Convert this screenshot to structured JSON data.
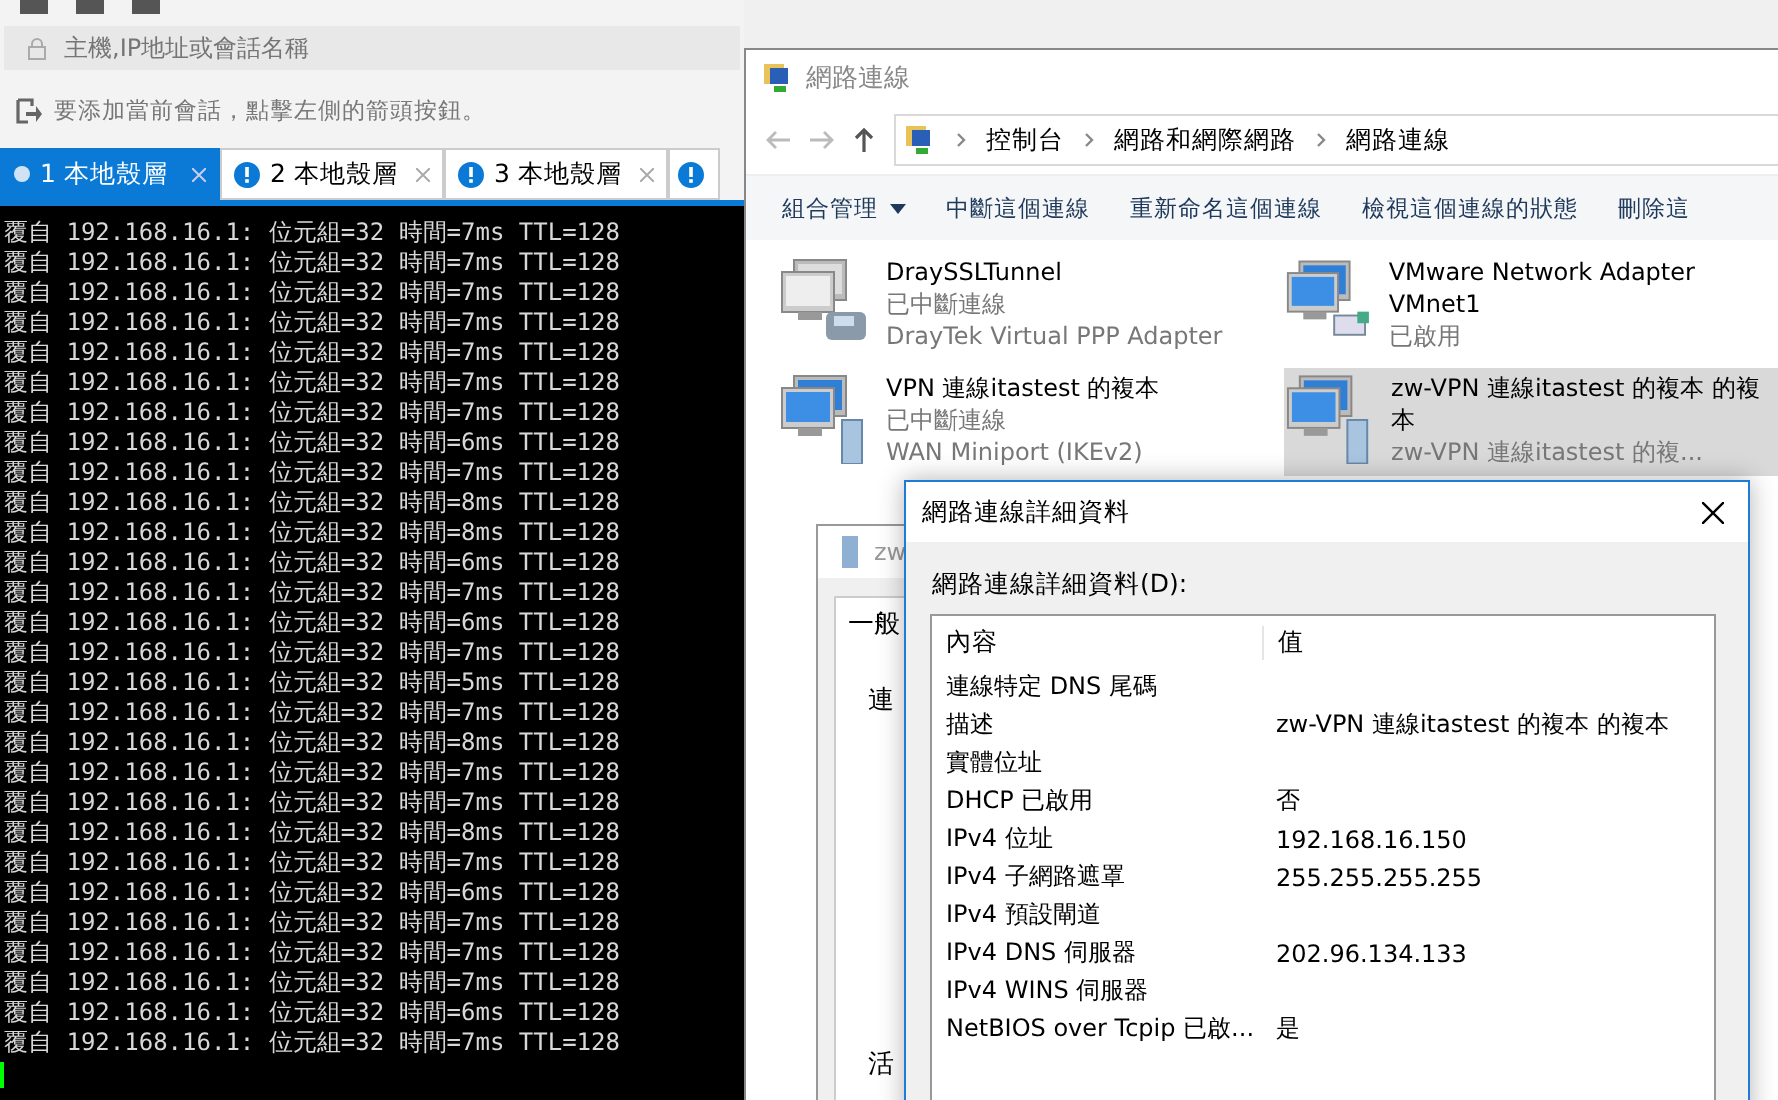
{
  "session_bar": {
    "placeholder": "主機,IP地址或會話名稱",
    "hint": "要添加當前會話，點擊左側的箭頭按鈕。"
  },
  "tabs": [
    {
      "label": "1 本地殼層",
      "selected": true,
      "kind": "active"
    },
    {
      "label": "2 本地殼層",
      "selected": false,
      "kind": "alert"
    },
    {
      "label": "3 本地殼層",
      "selected": false,
      "kind": "alert"
    }
  ],
  "terminal": {
    "lines": [
      "覆自 192.168.16.1: 位元組=32 時間=7ms TTL=128",
      "覆自 192.168.16.1: 位元組=32 時間=7ms TTL=128",
      "覆自 192.168.16.1: 位元組=32 時間=7ms TTL=128",
      "覆自 192.168.16.1: 位元組=32 時間=7ms TTL=128",
      "覆自 192.168.16.1: 位元組=32 時間=7ms TTL=128",
      "覆自 192.168.16.1: 位元組=32 時間=7ms TTL=128",
      "覆自 192.168.16.1: 位元組=32 時間=7ms TTL=128",
      "覆自 192.168.16.1: 位元組=32 時間=6ms TTL=128",
      "覆自 192.168.16.1: 位元組=32 時間=7ms TTL=128",
      "覆自 192.168.16.1: 位元組=32 時間=8ms TTL=128",
      "覆自 192.168.16.1: 位元組=32 時間=8ms TTL=128",
      "覆自 192.168.16.1: 位元組=32 時間=6ms TTL=128",
      "覆自 192.168.16.1: 位元組=32 時間=7ms TTL=128",
      "覆自 192.168.16.1: 位元組=32 時間=6ms TTL=128",
      "覆自 192.168.16.1: 位元組=32 時間=7ms TTL=128",
      "覆自 192.168.16.1: 位元組=32 時間=5ms TTL=128",
      "覆自 192.168.16.1: 位元組=32 時間=7ms TTL=128",
      "覆自 192.168.16.1: 位元組=32 時間=8ms TTL=128",
      "覆自 192.168.16.1: 位元組=32 時間=7ms TTL=128",
      "覆自 192.168.16.1: 位元組=32 時間=7ms TTL=128",
      "覆自 192.168.16.1: 位元組=32 時間=8ms TTL=128",
      "覆自 192.168.16.1: 位元組=32 時間=7ms TTL=128",
      "覆自 192.168.16.1: 位元組=32 時間=6ms TTL=128",
      "覆自 192.168.16.1: 位元組=32 時間=7ms TTL=128",
      "覆自 192.168.16.1: 位元組=32 時間=7ms TTL=128",
      "覆自 192.168.16.1: 位元組=32 時間=7ms TTL=128",
      "覆自 192.168.16.1: 位元組=32 時間=6ms TTL=128",
      "覆自 192.168.16.1: 位元組=32 時間=7ms TTL=128"
    ]
  },
  "network_window": {
    "title": "網路連線",
    "breadcrumb": [
      "控制台",
      "網路和網際網路",
      "網路連線"
    ],
    "toolbar": [
      {
        "label": "組合管理",
        "kind": "menu"
      },
      {
        "label": "中斷這個連線",
        "kind": "action"
      },
      {
        "label": "重新命名這個連線",
        "kind": "action"
      },
      {
        "label": "檢視這個連線的狀態",
        "kind": "action"
      },
      {
        "label": "刪除這",
        "kind": "action"
      }
    ],
    "connections": [
      {
        "name": "DraySSLTunnel",
        "status": "已中斷連線",
        "device": "DrayTek Virtual PPP Adapter",
        "kind": "phone",
        "selected": false
      },
      {
        "name": "VMware Network Adapter VMnet1",
        "status": "已啟用",
        "kind": "ethernet",
        "selected": false
      },
      {
        "name": "VPN 連線itastest 的複本",
        "status": "已中斷連線",
        "device": "WAN Miniport (IKEv2)",
        "kind": "server",
        "selected": false
      },
      {
        "name": "zw-VPN 連線itastest 的複本 的複本",
        "status": "zw-VPN 連線itastest 的複...",
        "kind": "server",
        "selected": true
      }
    ]
  },
  "properties_window": {
    "title": "zw",
    "tab": "一般",
    "labels": [
      "連",
      "活"
    ]
  },
  "details_dialog": {
    "title": "網路連線詳細資料",
    "label": "網路連線詳細資料(D):",
    "columns": [
      "內容",
      "值"
    ],
    "rows": [
      [
        "連線特定 DNS 尾碼",
        ""
      ],
      [
        "描述",
        "zw-VPN 連線itastest 的複本 的複本"
      ],
      [
        "實體位址",
        ""
      ],
      [
        "DHCP 已啟用",
        "否"
      ],
      [
        "IPv4 位址",
        "192.168.16.150"
      ],
      [
        "IPv4 子網路遮罩",
        "255.255.255.255"
      ],
      [
        "IPv4 預設閘道",
        ""
      ],
      [
        "IPv4 DNS 伺服器",
        "202.96.134.133"
      ],
      [
        "IPv4 WINS 伺服器",
        ""
      ],
      [
        "NetBIOS over Tcpip 已啟...",
        "是"
      ]
    ]
  }
}
